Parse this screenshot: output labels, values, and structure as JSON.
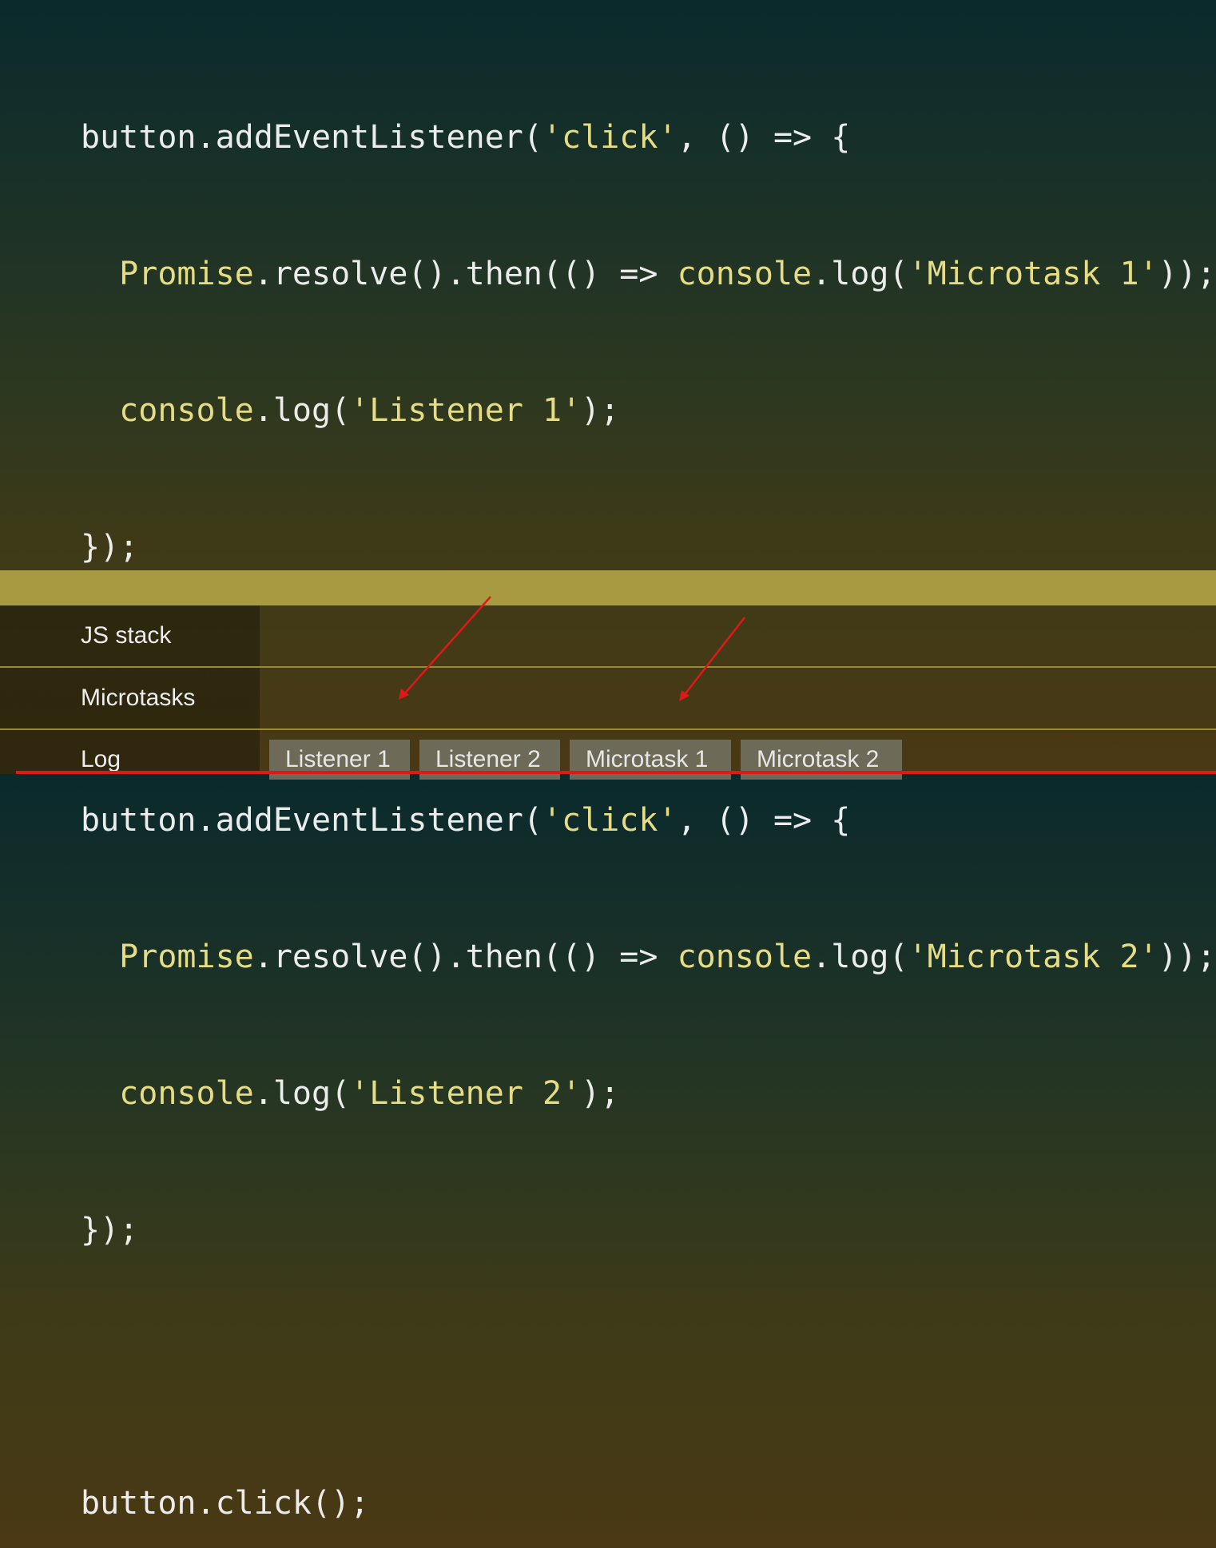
{
  "code": {
    "line1": {
      "a": "button.addEventListener(",
      "b": "'click'",
      "c": ", () => {"
    },
    "line2": {
      "a": "  Promise",
      "b": ".resolve().then(() => ",
      "c": "console",
      "d": ".log(",
      "e": "'Microtask 1'",
      "f": "));"
    },
    "line3": {
      "a": "  console",
      "b": ".log(",
      "c": "'Listener 1'",
      "d": ");"
    },
    "line4": "});",
    "line5": {
      "a": "button.addEventListener(",
      "b": "'click'",
      "c": ", () => {"
    },
    "line6": {
      "a": "  Promise",
      "b": ".resolve().then(() => ",
      "c": "console",
      "d": ".log(",
      "e": "'Microtask 2'",
      "f": "));"
    },
    "line7": {
      "a": "  console",
      "b": ".log(",
      "c": "'Listener 2'",
      "d": ");"
    },
    "line8": "});",
    "line9": "button.click();"
  },
  "rows": {
    "js_stack": {
      "label": "JS stack"
    },
    "microtasks": {
      "label": "Microtasks"
    },
    "log": {
      "label": "Log",
      "items": [
        "Listener 1",
        "Listener 2",
        "Microtask 1",
        "Microtask 2"
      ]
    }
  },
  "colors": {
    "code_text": "#ececec",
    "code_highlight": "#e6dc84",
    "bar": "#a89a40",
    "chip": "#6e6a58",
    "annotation": "#e01818"
  }
}
